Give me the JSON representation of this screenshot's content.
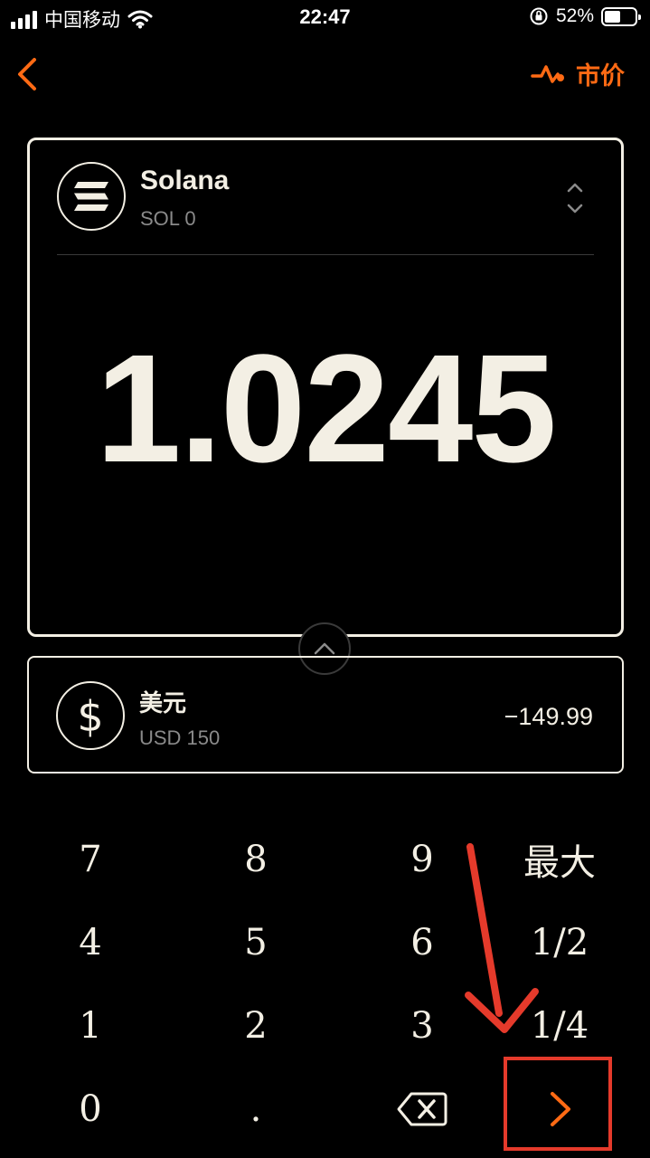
{
  "status_bar": {
    "carrier": "中国移动",
    "time": "22:47",
    "battery_percent": "52%",
    "battery_level": 0.52
  },
  "header": {
    "market_label": "市价",
    "accent_color": "#ff6a14"
  },
  "token": {
    "name": "Solana",
    "balance": "SOL 0",
    "amount": "1.0245",
    "icon": "solana-icon"
  },
  "fiat": {
    "name": "美元",
    "balance": "USD 150",
    "value": "−149.99",
    "icon": "dollar-icon"
  },
  "keypad": {
    "k7": "7",
    "k8": "8",
    "k9": "9",
    "max": "最大",
    "k4": "4",
    "k5": "5",
    "k6": "6",
    "half": "1/2",
    "k1": "1",
    "k2": "2",
    "k3": "3",
    "quarter": "1/4",
    "k0": "0",
    "dot": "."
  },
  "annotation": {
    "color": "#e53a2b"
  }
}
